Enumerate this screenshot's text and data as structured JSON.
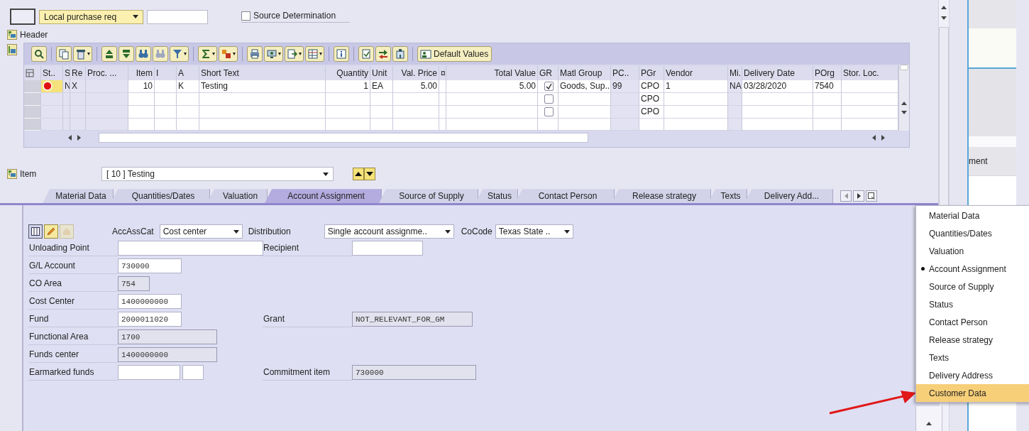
{
  "top_bar": {
    "document_type": "Local purchase req",
    "source_determination": {
      "label": "Source Determination",
      "checked": false
    }
  },
  "header": {
    "label": "Header"
  },
  "grid": {
    "toolbar_button": "Default Values",
    "columns": [
      {
        "label": "St..",
        "editable": false
      },
      {
        "label": "S",
        "editable": false
      },
      {
        "label": "Re",
        "editable": false
      },
      {
        "label": "Proc. ...",
        "editable": false
      },
      {
        "label": "Item",
        "editable": true
      },
      {
        "label": "I",
        "editable": true
      },
      {
        "label": "A",
        "editable": true
      },
      {
        "label": "Short Text",
        "editable": true
      },
      {
        "label": "Quantity",
        "editable": true
      },
      {
        "label": "Unit",
        "editable": true
      },
      {
        "label": "Val. Price",
        "editable": true
      },
      {
        "label": "¤",
        "editable": true
      },
      {
        "label": "Total Value",
        "editable": true
      },
      {
        "label": "GR",
        "editable": true
      },
      {
        "label": "Matl Group",
        "editable": true
      },
      {
        "label": "PC..",
        "editable": false
      },
      {
        "label": "PGr",
        "editable": true
      },
      {
        "label": "Vendor",
        "editable": true
      },
      {
        "label": "Mi..",
        "editable": false
      },
      {
        "label": "Delivery Date",
        "editable": true
      },
      {
        "label": "POrg",
        "editable": true
      },
      {
        "label": "Stor. Loc.",
        "editable": true
      }
    ],
    "rows": [
      {
        "error": true,
        "cells": [
          null,
          "N",
          "X",
          null,
          "10",
          null,
          "K",
          "Testing",
          "1",
          "EA",
          "5.00",
          null,
          "5.00",
          null,
          "Goods, Sup...",
          "99",
          "CPO",
          "1",
          "NA",
          "03/28/2020",
          "7540",
          null
        ],
        "gr_checked": true
      },
      {
        "error": false,
        "cells": [
          null,
          null,
          null,
          null,
          null,
          null,
          null,
          null,
          null,
          null,
          null,
          null,
          null,
          null,
          null,
          null,
          "CPO",
          null,
          null,
          null,
          null,
          null
        ],
        "gr_checked": false
      },
      {
        "error": false,
        "cells": [
          null,
          null,
          null,
          null,
          null,
          null,
          null,
          null,
          null,
          null,
          null,
          null,
          null,
          null,
          null,
          null,
          "CPO",
          null,
          null,
          null,
          null,
          null
        ],
        "gr_checked": false
      }
    ]
  },
  "item_bar": {
    "label": "Item",
    "value": "[ 10 ] Testing"
  },
  "tabs": [
    {
      "label": "Material Data",
      "selected": false
    },
    {
      "label": "Quantities/Dates",
      "selected": false
    },
    {
      "label": "Valuation",
      "selected": false
    },
    {
      "label": "Account Assignment",
      "selected": true
    },
    {
      "label": "Source of Supply",
      "selected": false
    },
    {
      "label": "Status",
      "selected": false
    },
    {
      "label": "Contact Person",
      "selected": false
    },
    {
      "label": "Release strategy",
      "selected": false
    },
    {
      "label": "Texts",
      "selected": false
    },
    {
      "label": "Delivery Add...",
      "selected": false
    }
  ],
  "account_assignment": {
    "acc_ass_cat": {
      "label": "AccAssCat",
      "value": "Cost center"
    },
    "distribution": {
      "label": "Distribution",
      "value": "Single account assignme.."
    },
    "co_code": {
      "label": "CoCode",
      "value": "Texas State .."
    },
    "fields": [
      {
        "label": "Unloading Point",
        "editable": true,
        "right": {
          "label": "Recipient",
          "editable": true
        }
      },
      {
        "label": "G/L Account",
        "value": "730000",
        "editable": true
      },
      {
        "label": "CO Area",
        "value": "754",
        "editable": false
      },
      {
        "label": "Cost Center",
        "value": "1400000000",
        "editable": true
      },
      {
        "label": "Fund",
        "value": "2000011020",
        "editable": true,
        "right": {
          "label": "Grant",
          "value": "NOT_RELEVANT_FOR_GM",
          "editable": false
        }
      },
      {
        "label": "Functional Area",
        "value": "1700",
        "editable": false
      },
      {
        "label": "Funds center",
        "value": "1400000000",
        "editable": false
      },
      {
        "label": "Earmarked funds",
        "kind": "split",
        "editable": true,
        "right": {
          "label": "Commitment item",
          "value": "730000",
          "editable": false
        }
      }
    ]
  },
  "tab_menu": [
    {
      "label": "Material Data",
      "selected": false,
      "highlighted": false
    },
    {
      "label": "Quantities/Dates",
      "selected": false,
      "highlighted": false
    },
    {
      "label": "Valuation",
      "selected": false,
      "highlighted": false
    },
    {
      "label": "Account Assignment",
      "selected": true,
      "highlighted": false
    },
    {
      "label": "Source of Supply",
      "selected": false,
      "highlighted": false
    },
    {
      "label": "Status",
      "selected": false,
      "highlighted": false
    },
    {
      "label": "Contact Person",
      "selected": false,
      "highlighted": false
    },
    {
      "label": "Release strategy",
      "selected": false,
      "highlighted": false
    },
    {
      "label": "Texts",
      "selected": false,
      "highlighted": false
    },
    {
      "label": "Delivery Address",
      "selected": false,
      "highlighted": false
    },
    {
      "label": "Customer Data",
      "selected": false,
      "highlighted": true
    }
  ],
  "side_panel": {
    "text": "ment"
  }
}
